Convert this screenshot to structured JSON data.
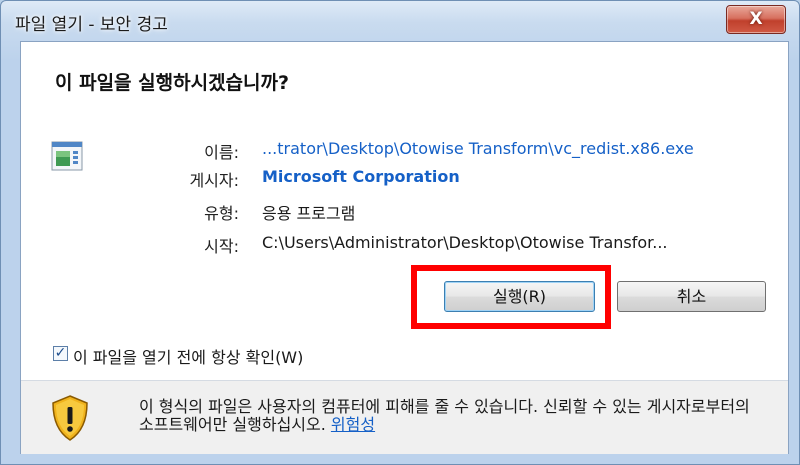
{
  "window": {
    "title": "파일 열기 - 보안 경고",
    "close_label": "X"
  },
  "dialog": {
    "heading": "이 파일을 실행하시겠습니까?",
    "file_icon": "executable-file-icon",
    "fields": [
      {
        "label": "이름:",
        "value": "...trator\\Desktop\\Otowise Transform\\vc_redist.x86.exe"
      },
      {
        "label": "게시자:",
        "value": "Microsoft Corporation"
      },
      {
        "label": "유형:",
        "value": "응용 프로그램"
      },
      {
        "label": "시작:",
        "value": "C:\\Users\\Administrator\\Desktop\\Otowise Transfor..."
      }
    ],
    "buttons": {
      "run": "실행(R)",
      "cancel": "취소"
    },
    "checkbox": {
      "checked": true,
      "label": "이 파일을 열기 전에 항상 확인(W)"
    },
    "warning": {
      "icon": "security-shield-icon",
      "text": "이 형식의 파일은 사용자의 컴퓨터에 피해를 줄 수 있습니다. 신뢰할 수 있는 게시자로부터의 소프트웨어만 실행하십시오.",
      "link": "위험성"
    }
  },
  "colors": {
    "link": "#1560c7",
    "highlight": "#ff0000",
    "window_frame": "#bcd2ec"
  }
}
